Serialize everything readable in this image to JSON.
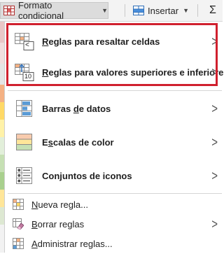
{
  "ribbon": {
    "formato_label": "Formato condicional",
    "insertar_label": "Insertar",
    "sum_symbol": "Σ"
  },
  "menu": {
    "items": [
      {
        "label": "Reglas para resaltar celdas",
        "accel": "R",
        "icon": "highlight-cells-rules-icon",
        "submenu": true
      },
      {
        "label": "Reglas para valores superiores e inferiores",
        "accel": "R",
        "icon": "top-bottom-rules-icon",
        "submenu": true
      },
      {
        "label": "Barras de datos",
        "accel": "d",
        "icon": "data-bars-icon",
        "submenu": true
      },
      {
        "label": "Escalas de color",
        "accel": "s",
        "icon": "color-scales-icon",
        "submenu": true
      },
      {
        "label": "Conjuntos de iconos",
        "accel": "j",
        "icon": "icon-sets-icon",
        "submenu": true
      },
      {
        "label": "Nueva regla...",
        "accel": "N",
        "icon": "new-rule-icon",
        "submenu": false
      },
      {
        "label": "Borrar reglas",
        "accel": "B",
        "icon": "clear-rules-icon",
        "submenu": true
      },
      {
        "label": "Administrar reglas...",
        "accel": "A",
        "icon": "manage-rules-icon",
        "submenu": false
      }
    ],
    "icon_text": {
      "less_than": "<",
      "ten": "10"
    },
    "arrow": ">"
  },
  "colors": {
    "highlight_border": "#d0202e",
    "menu_background": "#ffffff",
    "ribbon_background": "#f3f3f3"
  }
}
